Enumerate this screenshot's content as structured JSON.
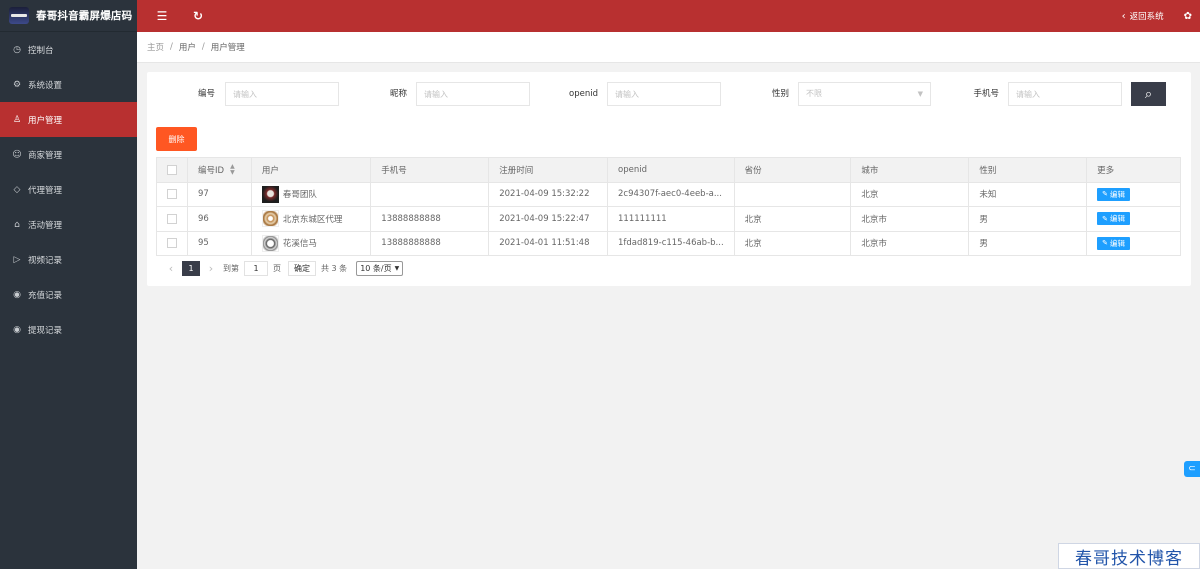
{
  "brand": {
    "title": "春哥抖音霸屏爆店码"
  },
  "sidebar": {
    "items": [
      {
        "label": "控制台",
        "icon": "dashboard-icon",
        "glyph": "◷",
        "active": false
      },
      {
        "label": "系统设置",
        "icon": "gear-icon",
        "glyph": "⚙",
        "active": false
      },
      {
        "label": "用户管理",
        "icon": "user-icon",
        "glyph": "♙",
        "active": true
      },
      {
        "label": "商家管理",
        "icon": "smile-icon",
        "glyph": "☺",
        "active": false
      },
      {
        "label": "代理管理",
        "icon": "diamond-icon",
        "glyph": "◇",
        "active": false
      },
      {
        "label": "活动管理",
        "icon": "tag-icon",
        "glyph": "⌂",
        "active": false
      },
      {
        "label": "视频记录",
        "icon": "video-icon",
        "glyph": "▷",
        "active": false
      },
      {
        "label": "充值记录",
        "icon": "coin-icon",
        "glyph": "◉",
        "active": false
      },
      {
        "label": "提现记录",
        "icon": "coin-icon",
        "glyph": "◉",
        "active": false
      }
    ]
  },
  "topbar": {
    "menu_icon": "☰",
    "refresh_icon": "↻",
    "back_label": "返回系统",
    "back_chevron": "‹",
    "palette_icon": "✿"
  },
  "breadcrumb": {
    "home": "主页",
    "sep": "/",
    "level1": "用户",
    "level2": "用户管理"
  },
  "filters": {
    "id_label": "编号",
    "id_placeholder": "请输入",
    "nick_label": "昵称",
    "nick_placeholder": "请输入",
    "openid_label": "openid",
    "openid_placeholder": "请输入",
    "gender_label": "性别",
    "gender_value": "不限",
    "phone_label": "手机号",
    "phone_placeholder": "请输入",
    "search_icon": "⌕"
  },
  "toolbar": {
    "delete_label": "删除"
  },
  "table": {
    "headers": {
      "id": "编号ID",
      "user": "用户",
      "phone": "手机号",
      "reg_time": "注册时间",
      "openid": "openid",
      "province": "省份",
      "city": "城市",
      "gender": "性别",
      "more": "更多"
    },
    "rows": [
      {
        "id": "97",
        "avatar": "av-1",
        "name": "春哥团队",
        "phone": "",
        "reg_time": "2021-04-09 15:32:22",
        "openid": "2c94307f-aec0-4eeb-a...",
        "province": "",
        "city": "北京",
        "gender": "未知",
        "edit": "编辑"
      },
      {
        "id": "96",
        "avatar": "av-2",
        "name": "北京东城区代理",
        "phone": "13888888888",
        "reg_time": "2021-04-09 15:22:47",
        "openid": "111111111",
        "province": "北京",
        "city": "北京市",
        "gender": "男",
        "edit": "编辑"
      },
      {
        "id": "95",
        "avatar": "av-3",
        "name": "花溪信马",
        "phone": "13888888888",
        "reg_time": "2021-04-01 11:51:48",
        "openid": "1fdad819-c115-46ab-b...",
        "province": "北京",
        "city": "北京市",
        "gender": "男",
        "edit": "编辑"
      }
    ]
  },
  "pager": {
    "prev": "‹",
    "next": "›",
    "current": "1",
    "goto_label": "到第",
    "goto_value": "1",
    "page_unit": "页",
    "confirm": "确定",
    "total": "共 3 条",
    "page_size": "10 条/页"
  },
  "float_icon": "⊂",
  "watermark": "春哥技术博客"
}
